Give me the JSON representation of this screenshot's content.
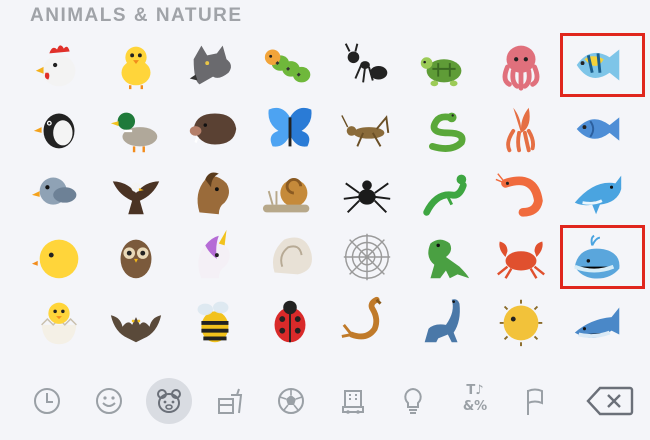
{
  "keyboard": {
    "section_title": "ANIMALS & NATURE",
    "highlight_color": "#e0261d",
    "grid": [
      [
        "chicken",
        "baby-chick",
        "wolf",
        "bug",
        "ant",
        "turtle",
        "octopus",
        "tropical-fish"
      ],
      [
        "penguin",
        "duck",
        "boar",
        "butterfly",
        "cricket",
        "snake",
        "squid",
        "fish"
      ],
      [
        "bird",
        "eagle",
        "horse",
        "snail",
        "spider",
        "lizard",
        "shrimp",
        "dolphin"
      ],
      [
        "front-facing-chick",
        "owl",
        "unicorn",
        "spiral-shell",
        "spider-web",
        "t-rex",
        "crab",
        "spouting-whale"
      ],
      [
        "hatching-chick",
        "bat",
        "honeybee",
        "lady-beetle",
        "scorpion",
        "sauropod",
        "blowfish",
        "whale"
      ]
    ],
    "highlighted": [
      "tropical-fish",
      "spouting-whale"
    ],
    "toolbar": {
      "categories": [
        "recent-icon",
        "smileys-icon",
        "animals-icon",
        "food-icon",
        "activity-icon",
        "travel-icon",
        "objects-icon",
        "symbols-icon",
        "flags-icon"
      ],
      "selected": "animals-icon",
      "symbols_line1": "T♪",
      "symbols_line2": "&%",
      "backspace": "backspace-icon"
    }
  }
}
